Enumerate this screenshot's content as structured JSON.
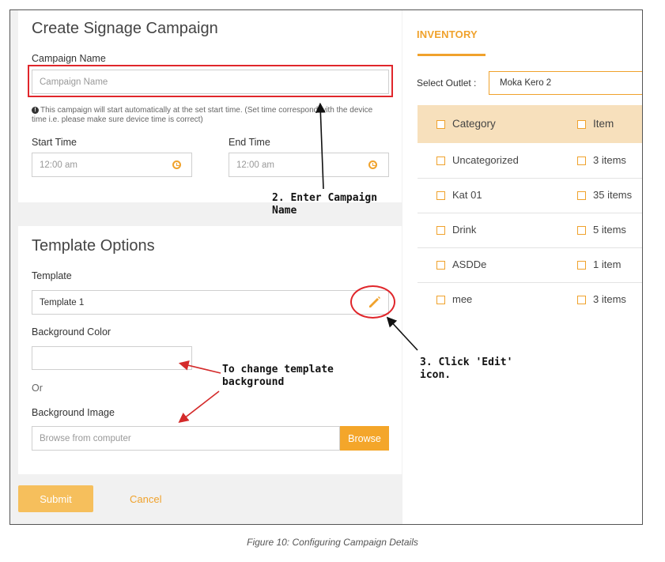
{
  "campaign": {
    "title": "Create Signage Campaign",
    "name_label": "Campaign Name",
    "name_placeholder": "Campaign Name",
    "note": "This campaign will start automatically at the set start time. (Set time correspond with the device time i.e. please make sure device time is correct)",
    "start_label": "Start Time",
    "start_value": "12:00 am",
    "end_label": "End Time",
    "end_value": "12:00 am"
  },
  "template": {
    "title": "Template Options",
    "template_label": "Template",
    "template_value": "Template 1",
    "bg_color_label": "Background Color",
    "or_text": "Or",
    "bg_image_label": "Background Image",
    "bg_image_placeholder": "Browse from computer",
    "browse_label": "Browse"
  },
  "actions": {
    "submit_label": "Submit",
    "cancel_label": "Cancel"
  },
  "inventory": {
    "tab_label": "INVENTORY",
    "outlet_label": "Select Outlet :",
    "outlet_value": "Moka Kero 2",
    "headers": {
      "category": "Category",
      "item": "Item"
    },
    "rows": [
      {
        "category": "Uncategorized",
        "items": "3 items"
      },
      {
        "category": "Kat 01",
        "items": "35 items"
      },
      {
        "category": "Drink",
        "items": "5 items"
      },
      {
        "category": "ASDDe",
        "items": "1 item"
      },
      {
        "category": "mee",
        "items": "3 items"
      }
    ]
  },
  "annotations": {
    "step2": [
      "2. Enter Campaign",
      "Name"
    ],
    "step3": [
      "3. Click 'Edit'",
      "icon."
    ],
    "bg_note": [
      "To change template",
      "background"
    ]
  },
  "caption": "Figure 10: Configuring Campaign Details",
  "colors": {
    "accent": "#f0a22c",
    "header_bg": "#f7e0bc",
    "highlight": "#e0262b"
  },
  "icons": [
    "info-icon",
    "clock-icon",
    "pencil-icon",
    "checkbox-icon"
  ]
}
